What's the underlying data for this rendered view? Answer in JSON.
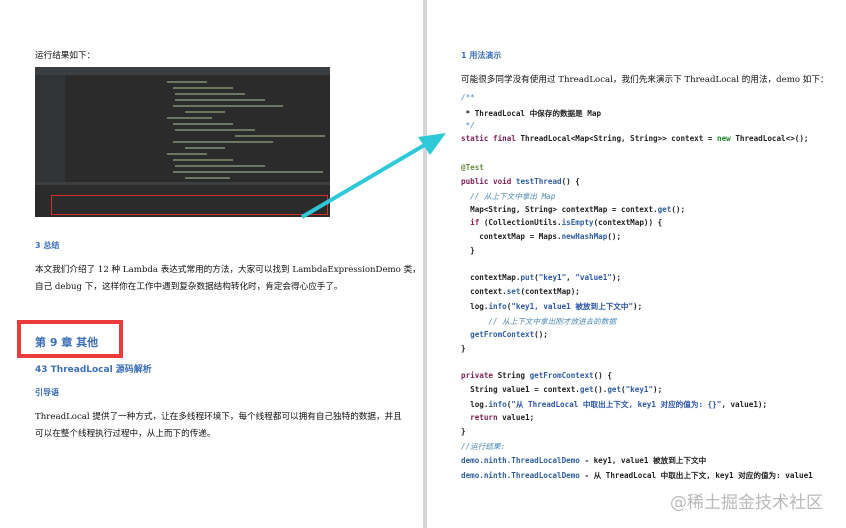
{
  "left": {
    "run_result_label": "运行结果如下：",
    "summary_heading": "3 总结",
    "summary_p1": "本文我们介绍了 12 种 Lambda 表达式常用的方法，大家可以找到 LambdaExpressionDemo 类，",
    "summary_p2": "自己 debug 下，这样你在工作中遇到复杂数据结构转化时，肯定会得心应手了。",
    "chapter_title": "第 9 章 其他",
    "section_title": "43 ThreadLocal 源码解析",
    "intro_heading": "引导语",
    "intro_p1": "ThreadLocal 提供了一种方式，让在多线程环境下，每个线程都可以拥有自己独特的数据，并且",
    "intro_p2": "可以在整个线程执行过程中，从上而下的传递。"
  },
  "right": {
    "heading": "1 用法演示",
    "intro": "可能很多同学没有使用过 ThreadLocal，我们先来演示下 ThreadLocal 的用法，demo 如下：",
    "code": [
      [
        [
          "/**",
          "cm"
        ]
      ],
      [
        [
          " * ThreadLocal 中保存的数据是 Map",
          ""
        ]
      ],
      [
        [
          " */",
          "cm"
        ]
      ],
      [
        [
          "static final ",
          "kw"
        ],
        [
          "ThreadLocal<Map<String, String>> context = ",
          ""
        ],
        [
          "new ",
          "nw"
        ],
        [
          "ThreadLocal<>();",
          ""
        ]
      ],
      [],
      [
        [
          "@Test",
          "ann"
        ]
      ],
      [
        [
          "public void ",
          "kw"
        ],
        [
          "testThread",
          "fn"
        ],
        [
          "() {",
          ""
        ]
      ],
      [
        [
          "  // 从上下文中拿出 Map",
          "cm"
        ]
      ],
      [
        [
          "  Map<String, String> contextMap = context.",
          ""
        ],
        [
          "get",
          "fn"
        ],
        [
          "();",
          ""
        ]
      ],
      [
        [
          "  if ",
          "kw"
        ],
        [
          "(CollectionUtils.",
          ""
        ],
        [
          "isEmpty",
          "fn"
        ],
        [
          "(contextMap)) {",
          ""
        ]
      ],
      [
        [
          "    contextMap = Maps.",
          ""
        ],
        [
          "newHashMap",
          "fn"
        ],
        [
          "();",
          ""
        ]
      ],
      [
        [
          "  }",
          ""
        ]
      ],
      [],
      [
        [
          "  contextMap.",
          ""
        ],
        [
          "put",
          "fn"
        ],
        [
          "(",
          ""
        ],
        [
          "\"key1\"",
          "str"
        ],
        [
          ", ",
          ""
        ],
        [
          "\"value1\"",
          "str"
        ],
        [
          ");",
          ""
        ]
      ],
      [
        [
          "  context.",
          ""
        ],
        [
          "set",
          "fn"
        ],
        [
          "(contextMap);",
          ""
        ]
      ],
      [
        [
          "  log.",
          ""
        ],
        [
          "info",
          "fn"
        ],
        [
          "(",
          ""
        ],
        [
          "\"key1, value1 被放到上下文中\"",
          "str"
        ],
        [
          ");",
          ""
        ]
      ],
      [
        [
          "      // 从上下文中拿出刚才放进去的数据",
          "cm"
        ]
      ],
      [
        [
          "  getFromContext",
          "fn"
        ],
        [
          "();",
          ""
        ]
      ],
      [
        [
          "}",
          ""
        ]
      ],
      [],
      [
        [
          "private ",
          "kw"
        ],
        [
          "String ",
          ""
        ],
        [
          "getFromContext",
          "fn"
        ],
        [
          "() {",
          ""
        ]
      ],
      [
        [
          "  String value1 = context.",
          ""
        ],
        [
          "get",
          "fn"
        ],
        [
          "().",
          ""
        ],
        [
          "get",
          "fn"
        ],
        [
          "(",
          ""
        ],
        [
          "\"key1\"",
          "str"
        ],
        [
          ");",
          ""
        ]
      ],
      [
        [
          "  log.",
          ""
        ],
        [
          "info",
          "fn"
        ],
        [
          "(",
          ""
        ],
        [
          "\"从 ThreadLocal 中取出上下文, key1 对应的值为: {}\"",
          "str"
        ],
        [
          ", value1);",
          ""
        ]
      ],
      [
        [
          "  return ",
          "kw"
        ],
        [
          "value1;",
          ""
        ]
      ],
      [
        [
          "}",
          ""
        ]
      ],
      [
        [
          "//运行结果:",
          "cm"
        ]
      ],
      [
        [
          "demo.ninth.ThreadLocalDemo",
          "fn"
        ],
        [
          " - key1, value1 被放到上下文中",
          ""
        ]
      ],
      [
        [
          "demo.ninth.ThreadLocalDemo",
          "fn"
        ],
        [
          " - 从 ThreadLocal 中取出上下文, key1 对应的值为: value1",
          ""
        ]
      ]
    ]
  },
  "watermark": "@稀土掘金技术社区",
  "colors": {
    "heading": "#3c6fb6",
    "highlight_box": "#ea3a3a",
    "arrow": "#2ec8d8"
  }
}
